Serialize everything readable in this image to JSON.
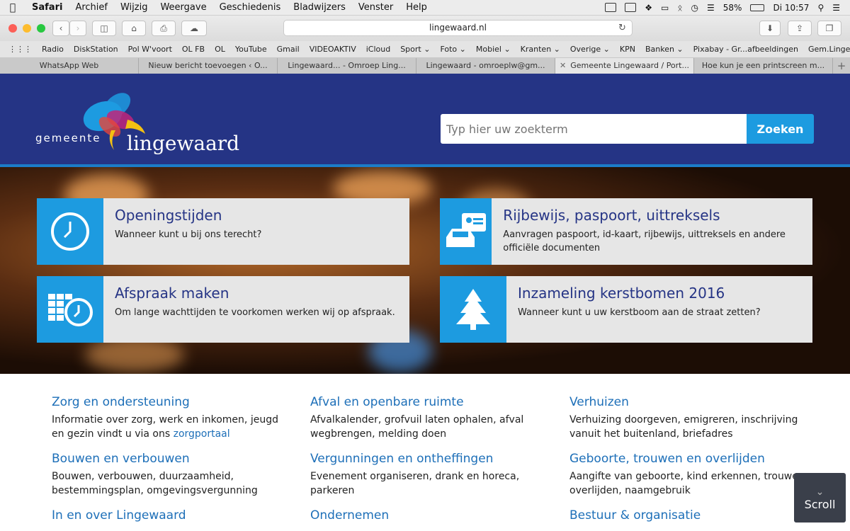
{
  "menubar": {
    "apple": "",
    "items": [
      "Safari",
      "Archief",
      "Wijzig",
      "Weergave",
      "Geschiedenis",
      "Bladwijzers",
      "Venster",
      "Help"
    ],
    "battery": "58%",
    "clock": "Di 10:57"
  },
  "toolbar": {
    "url": "lingewaard.nl"
  },
  "bookmarks": [
    "Radio",
    "DiskStation",
    "Pol W'voort",
    "OL FB",
    "OL",
    "YouTube",
    "Gmail",
    "VIDEOAKTIV",
    "iCloud",
    "Sport ⌄",
    "Foto ⌄",
    "Mobiel ⌄",
    "Kranten ⌄",
    "Overige ⌄",
    "KPN",
    "Banken ⌄",
    "Pixabay - Gr...afbeeldingen",
    "Gem.Lingewaard"
  ],
  "tabs": [
    {
      "label": "WhatsApp Web"
    },
    {
      "label": "Nieuw bericht toevoegen ‹ O..."
    },
    {
      "label": "Lingewaard... - Omroep Ling..."
    },
    {
      "label": "Lingewaard - omroeplw@gm..."
    },
    {
      "label": "Gemeente Lingewaard / Port..."
    },
    {
      "label": "Hoe kun je een printscreen m..."
    }
  ],
  "site": {
    "logo_gemeente": "gemeente",
    "logo_lingewaard": "lingewaard",
    "search_placeholder": "Typ hier uw zoekterm",
    "search_button": "Zoeken"
  },
  "tiles": [
    {
      "title": "Openingstijden",
      "desc": "Wanneer kunt u bij ons terecht?",
      "icon": "clock-icon"
    },
    {
      "title": "Rijbewijs, paspoort, uittreksels",
      "desc": "Aanvragen paspoort, id-kaart, rijbewijs, uittreksels en andere officiële documenten",
      "icon": "id-card-car-icon"
    },
    {
      "title": "Afspraak maken",
      "desc": "Om lange wachttijden te voorkomen werken wij op afspraak.",
      "icon": "calendar-clock-icon"
    },
    {
      "title": "Inzameling kerstbomen 2016",
      "desc": "Wanneer kunt u uw kerstboom aan de straat zetten?",
      "icon": "christmas-tree-icon"
    }
  ],
  "topics": [
    {
      "title": "Zorg en ondersteuning",
      "desc": "Informatie over zorg, werk en inkomen, jeugd en gezin vindt u via ons ",
      "link": "zorgportaal"
    },
    {
      "title": "Afval en openbare ruimte",
      "desc": "Afvalkalender, grofvuil laten ophalen, afval wegbrengen, melding doen"
    },
    {
      "title": "Verhuizen",
      "desc": "Verhuizing doorgeven, emigreren, inschrijving vanuit het buitenland, briefadres"
    },
    {
      "title": "Bouwen en verbouwen",
      "desc": "Bouwen, verbouwen, duurzaamheid, bestemmingsplan, omgevingsvergunning"
    },
    {
      "title": "Vergunningen en ontheffingen",
      "desc": "Evenement organiseren, drank en horeca, parkeren"
    },
    {
      "title": "Geboorte, trouwen en overlijden",
      "desc": "Aangifte van geboorte, kind erkennen, trouwen, overlijden, naamgebruik"
    },
    {
      "title": "In en over Lingewaard",
      "desc": ""
    },
    {
      "title": "Ondernemen",
      "desc": ""
    },
    {
      "title": "Bestuur & organisatie",
      "desc": ""
    }
  ],
  "scroll_label": "Scroll",
  "colors": {
    "header": "#253485",
    "accent": "#1d9be0",
    "link": "#1d6fb8"
  }
}
